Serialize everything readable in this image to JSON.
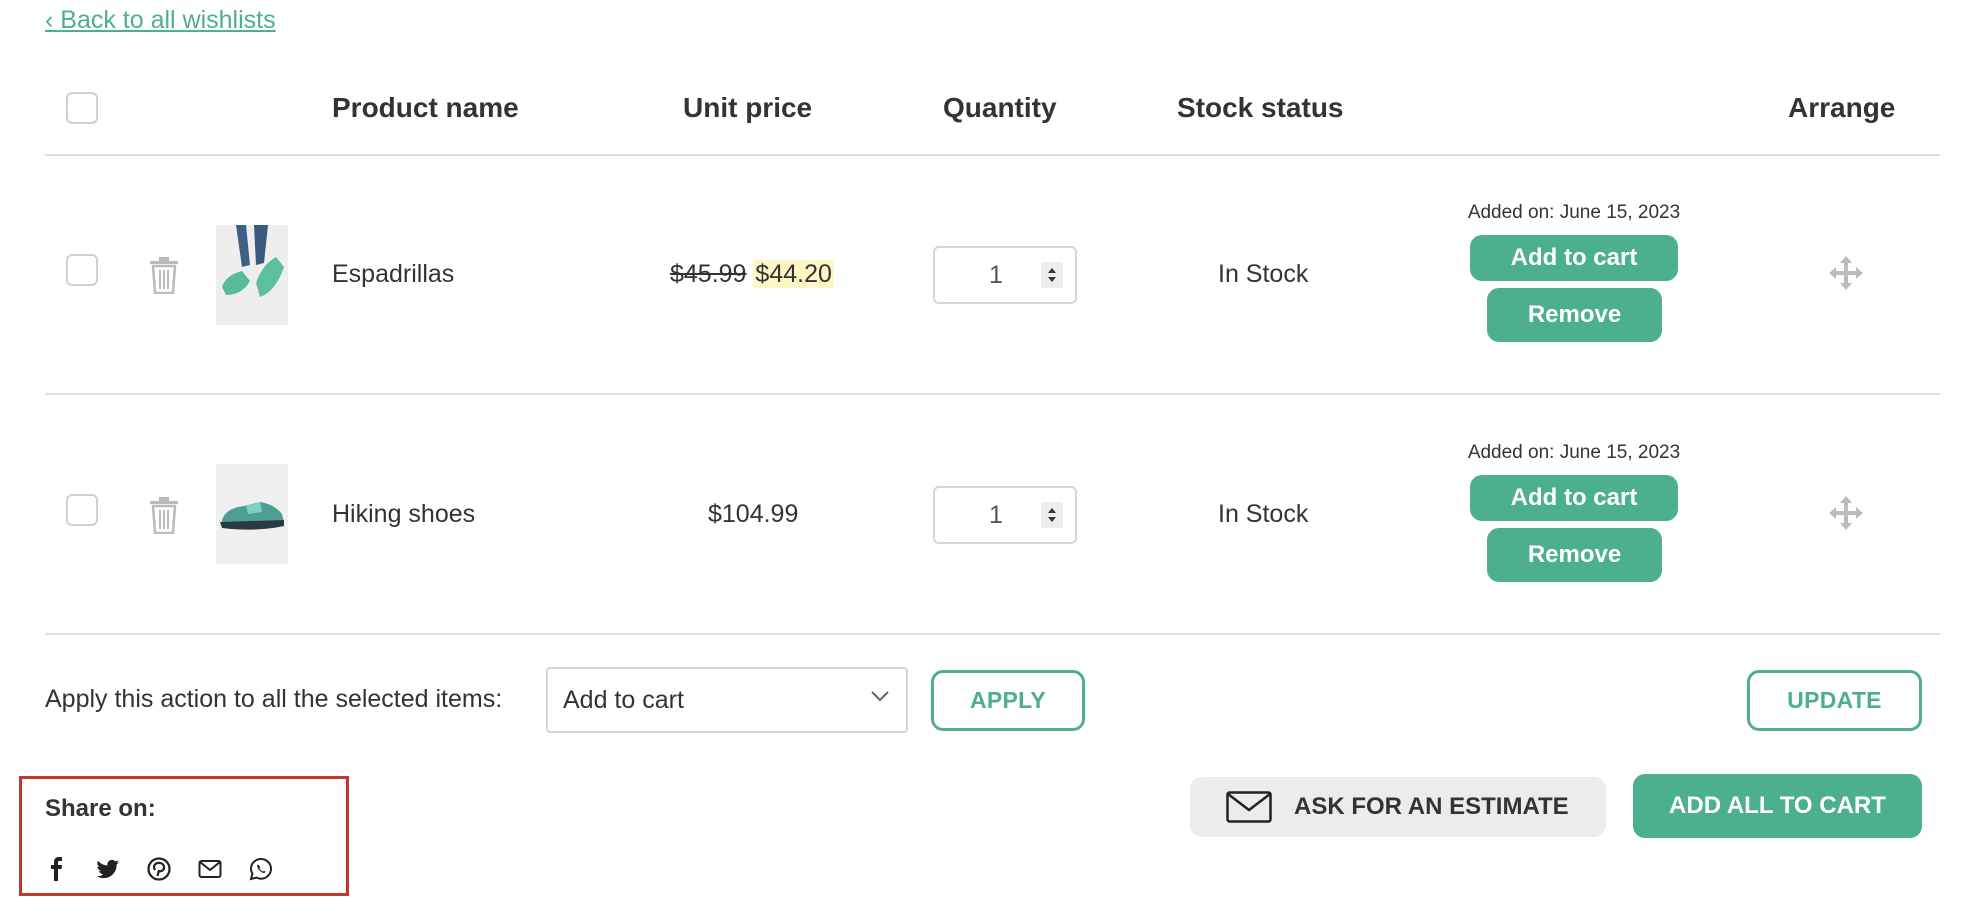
{
  "back_link": "‹ Back to all wishlists",
  "table": {
    "headers": {
      "product_name": "Product name",
      "unit_price": "Unit price",
      "quantity": "Quantity",
      "stock_status": "Stock status",
      "arrange": "Arrange"
    },
    "rows": [
      {
        "name": "Espadrillas",
        "price_old": "$45.99",
        "price_new": "$44.20",
        "quantity": "1",
        "stock": "In Stock",
        "added_on": "Added on: June 15, 2023",
        "add_to_cart": "Add to cart",
        "remove": "Remove"
      },
      {
        "name": "Hiking shoes",
        "price": "$104.99",
        "quantity": "1",
        "stock": "In Stock",
        "added_on": "Added on: June 15, 2023",
        "add_to_cart": "Add to cart",
        "remove": "Remove"
      }
    ]
  },
  "bulk_action": {
    "label": "Apply this action to all the selected items:",
    "selected_option": "Add to cart",
    "apply": "APPLY",
    "update": "UPDATE"
  },
  "share": {
    "label": "Share on:",
    "icons": [
      "facebook-icon",
      "twitter-icon",
      "pinterest-icon",
      "email-icon",
      "whatsapp-icon"
    ]
  },
  "actions": {
    "ask_estimate": "ASK FOR AN ESTIMATE",
    "add_all": "ADD ALL TO CART"
  },
  "colors": {
    "accent": "#4caf8f",
    "highlight": "#fff6c7",
    "share_border": "#c0392b"
  }
}
